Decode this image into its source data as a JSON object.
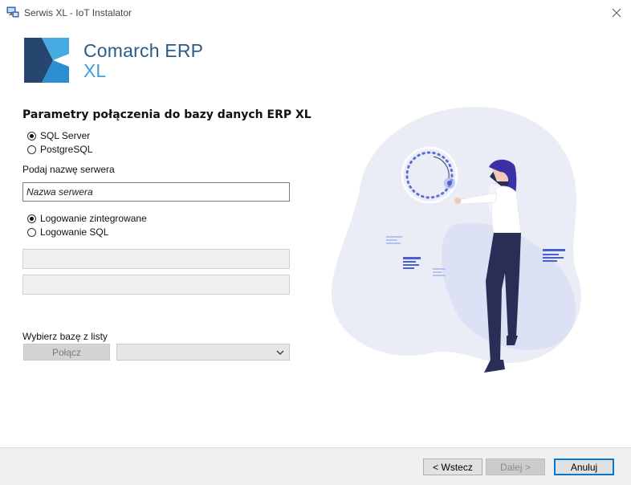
{
  "window": {
    "title": "Serwis XL - IoT Instalator",
    "icons": {
      "app": "computer-network-icon",
      "close": "close-icon"
    }
  },
  "brand": {
    "line1": "Comarch ERP",
    "line2": "XL",
    "colors": {
      "primary": "#2b5b86",
      "accent": "#3ea0d9"
    }
  },
  "form": {
    "title": "Parametry połączenia do bazy danych ERP XL",
    "db_engine": {
      "options": [
        {
          "label": "SQL Server",
          "checked": true
        },
        {
          "label": "PostgreSQL",
          "checked": false
        }
      ]
    },
    "server": {
      "label": "Podaj nazwę serwera",
      "placeholder": "Nazwa serwera",
      "value": ""
    },
    "auth": {
      "options": [
        {
          "label": "Logowanie zintegrowane",
          "checked": true
        },
        {
          "label": "Logowanie SQL",
          "checked": false
        }
      ]
    },
    "login_value": "",
    "password_value": "",
    "database": {
      "label": "Wybierz bazę z listy",
      "connect_label": "Połącz",
      "selected": ""
    }
  },
  "footer": {
    "back_label": "< Wstecz",
    "next_label": "Dalej >",
    "cancel_label": "Anuluj",
    "focus_color": "#0078d7"
  }
}
